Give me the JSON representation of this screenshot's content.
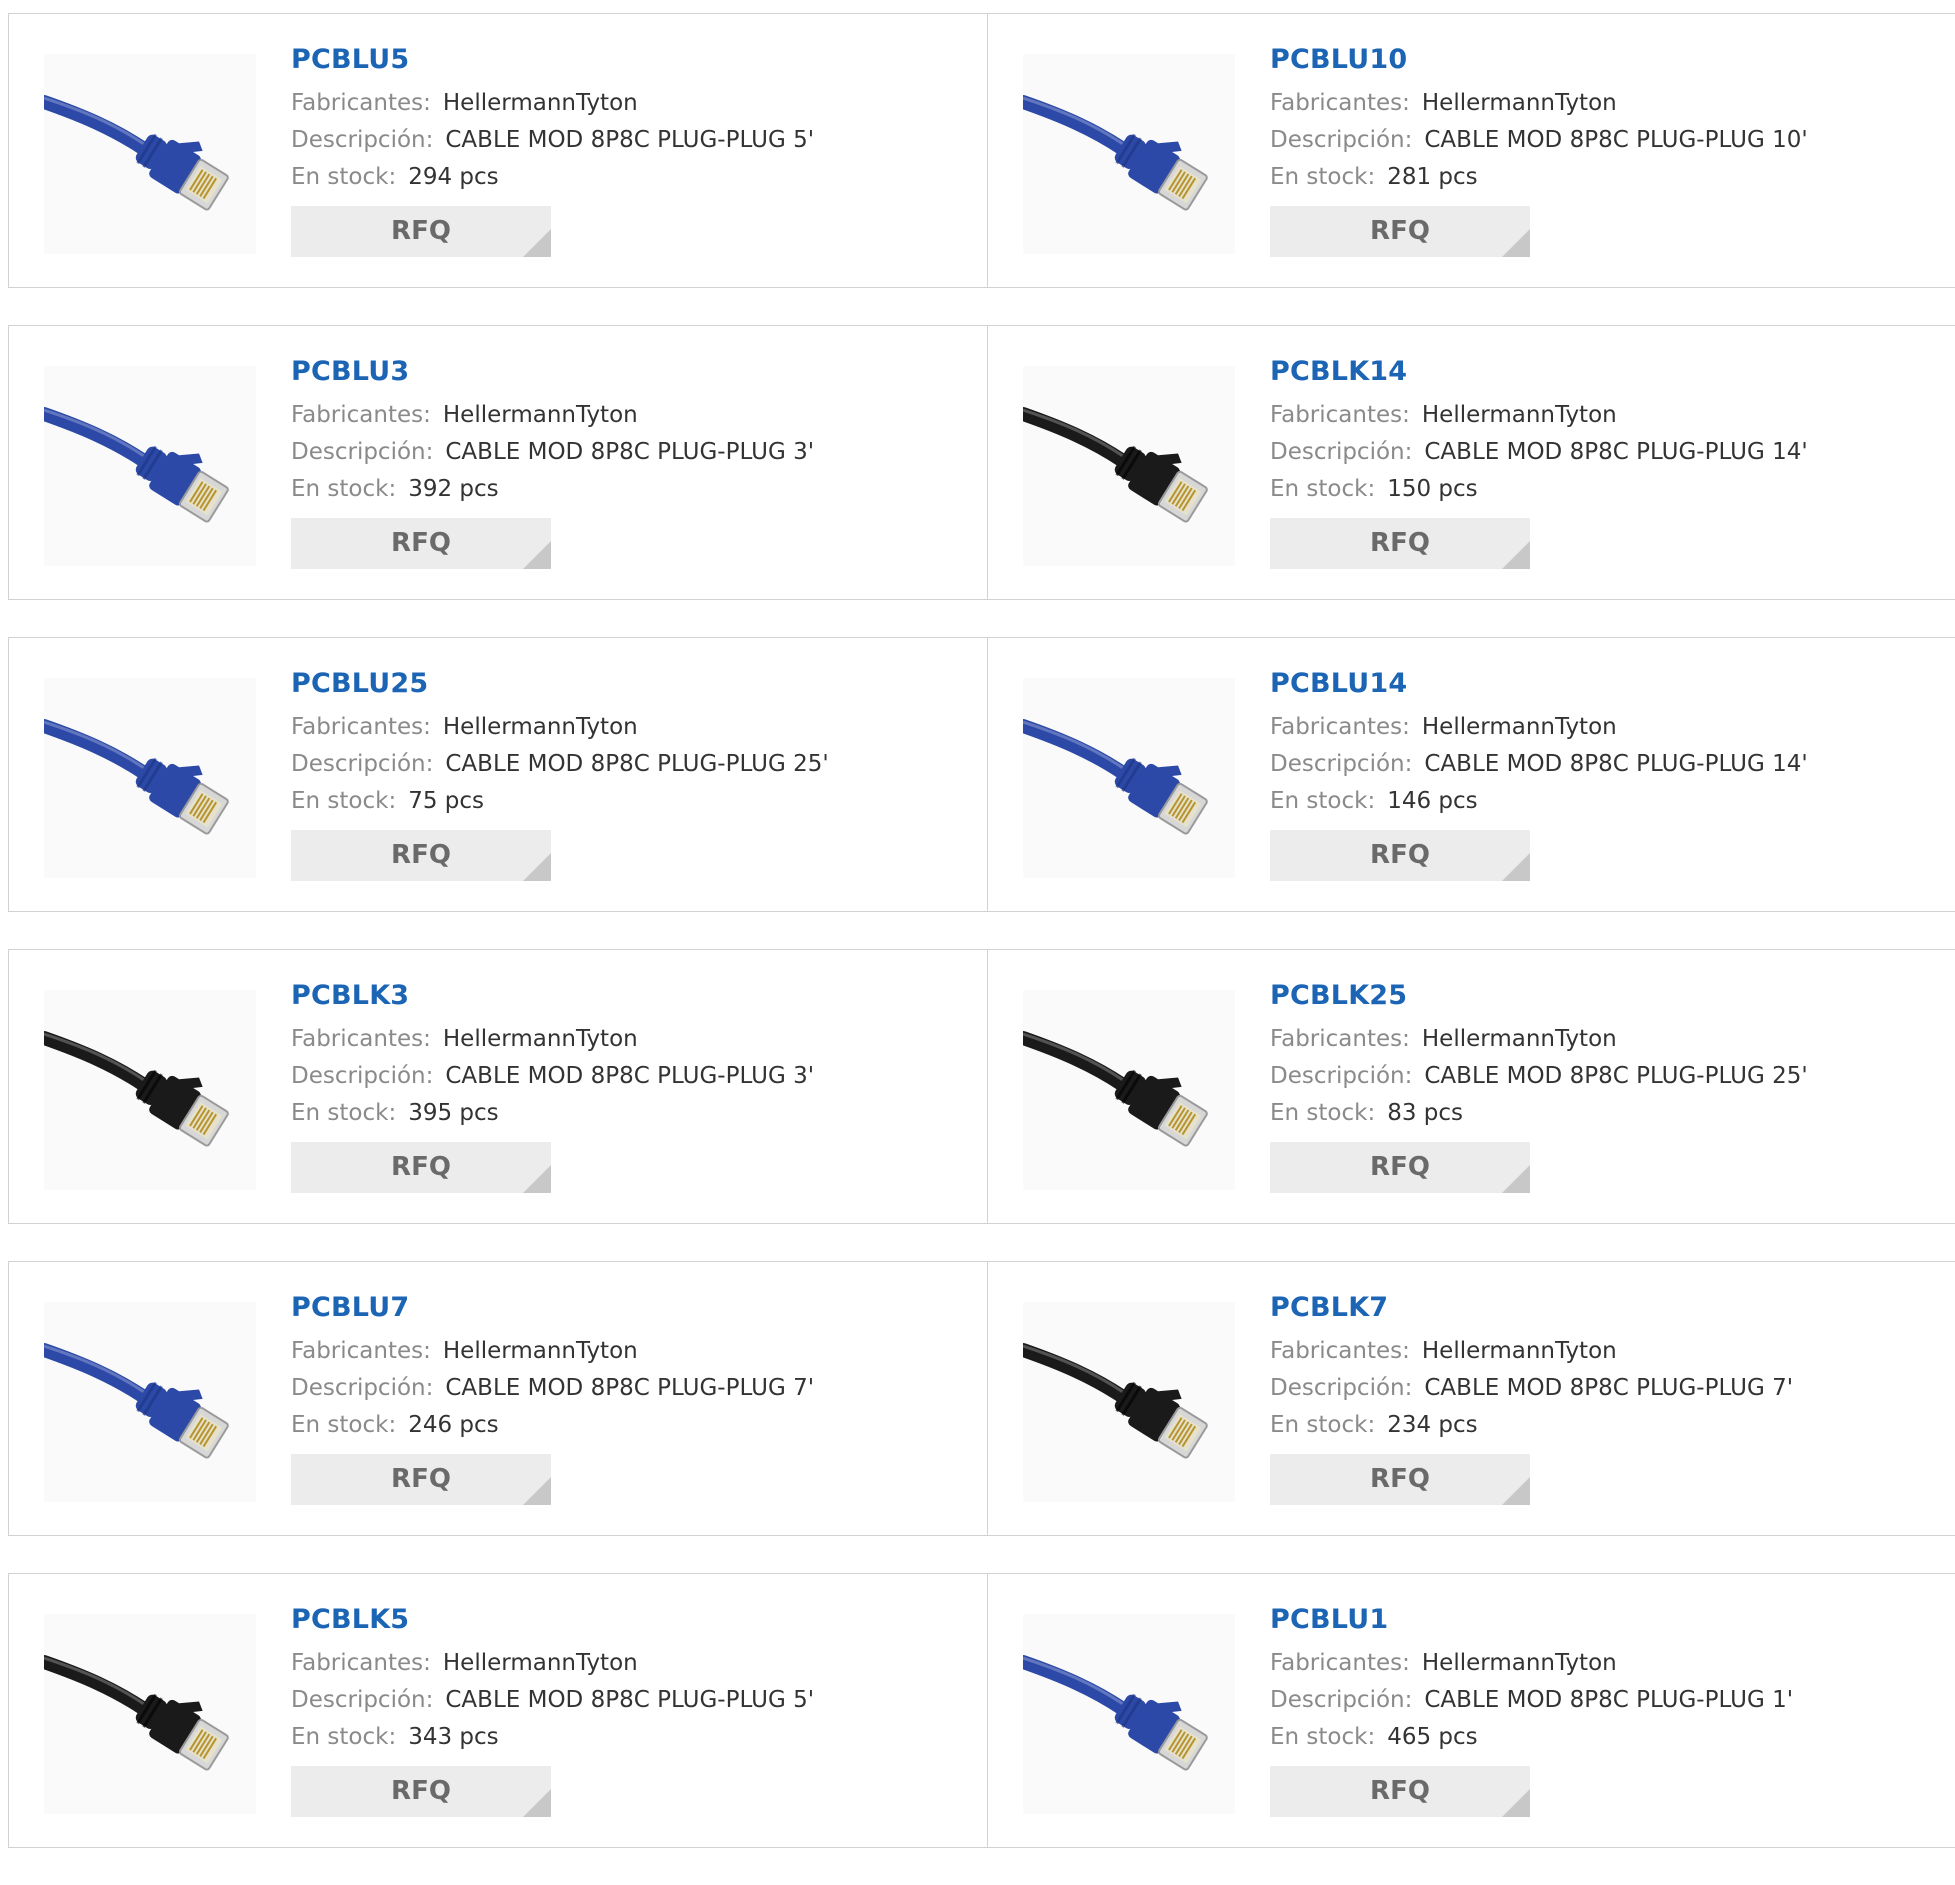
{
  "labels": {
    "manufacturer": "Fabricantes:",
    "description": "Descripción:",
    "stock": "En stock:",
    "rfq": "RFQ"
  },
  "colors": {
    "part_number": "#1c64b4",
    "cable_blue": "#2c49a8",
    "cable_black": "#1a1a1a"
  },
  "products": [
    {
      "part": "PCBLU5",
      "manufacturer": "HellermannTyton",
      "description": "CABLE MOD 8P8C PLUG-PLUG 5'",
      "stock": "294 pcs",
      "color": "blue",
      "image_icon": "blue-ethernet-cable-icon"
    },
    {
      "part": "PCBLU10",
      "manufacturer": "HellermannTyton",
      "description": "CABLE MOD 8P8C PLUG-PLUG 10'",
      "stock": "281 pcs",
      "color": "blue",
      "image_icon": "blue-ethernet-cable-icon"
    },
    {
      "part": "PCBLU3",
      "manufacturer": "HellermannTyton",
      "description": "CABLE MOD 8P8C PLUG-PLUG 3'",
      "stock": "392 pcs",
      "color": "blue",
      "image_icon": "blue-ethernet-cable-icon"
    },
    {
      "part": "PCBLK14",
      "manufacturer": "HellermannTyton",
      "description": "CABLE MOD 8P8C PLUG-PLUG 14'",
      "stock": "150 pcs",
      "color": "black",
      "image_icon": "black-ethernet-cable-icon"
    },
    {
      "part": "PCBLU25",
      "manufacturer": "HellermannTyton",
      "description": "CABLE MOD 8P8C PLUG-PLUG 25'",
      "stock": "75 pcs",
      "color": "blue",
      "image_icon": "blue-ethernet-cable-icon"
    },
    {
      "part": "PCBLU14",
      "manufacturer": "HellermannTyton",
      "description": "CABLE MOD 8P8C PLUG-PLUG 14'",
      "stock": "146 pcs",
      "color": "blue",
      "image_icon": "blue-ethernet-cable-icon"
    },
    {
      "part": "PCBLK3",
      "manufacturer": "HellermannTyton",
      "description": "CABLE MOD 8P8C PLUG-PLUG 3'",
      "stock": "395 pcs",
      "color": "black",
      "image_icon": "black-ethernet-cable-icon"
    },
    {
      "part": "PCBLK25",
      "manufacturer": "HellermannTyton",
      "description": "CABLE MOD 8P8C PLUG-PLUG 25'",
      "stock": "83 pcs",
      "color": "black",
      "image_icon": "black-ethernet-cable-icon"
    },
    {
      "part": "PCBLU7",
      "manufacturer": "HellermannTyton",
      "description": "CABLE MOD 8P8C PLUG-PLUG 7'",
      "stock": "246 pcs",
      "color": "blue",
      "image_icon": "blue-ethernet-cable-icon"
    },
    {
      "part": "PCBLK7",
      "manufacturer": "HellermannTyton",
      "description": "CABLE MOD 8P8C PLUG-PLUG 7'",
      "stock": "234 pcs",
      "color": "black",
      "image_icon": "black-ethernet-cable-icon"
    },
    {
      "part": "PCBLK5",
      "manufacturer": "HellermannTyton",
      "description": "CABLE MOD 8P8C PLUG-PLUG 5'",
      "stock": "343 pcs",
      "color": "black",
      "image_icon": "black-ethernet-cable-icon"
    },
    {
      "part": "PCBLU1",
      "manufacturer": "HellermannTyton",
      "description": "CABLE MOD 8P8C PLUG-PLUG 1'",
      "stock": "465 pcs",
      "color": "blue",
      "image_icon": "blue-ethernet-cable-icon"
    }
  ]
}
